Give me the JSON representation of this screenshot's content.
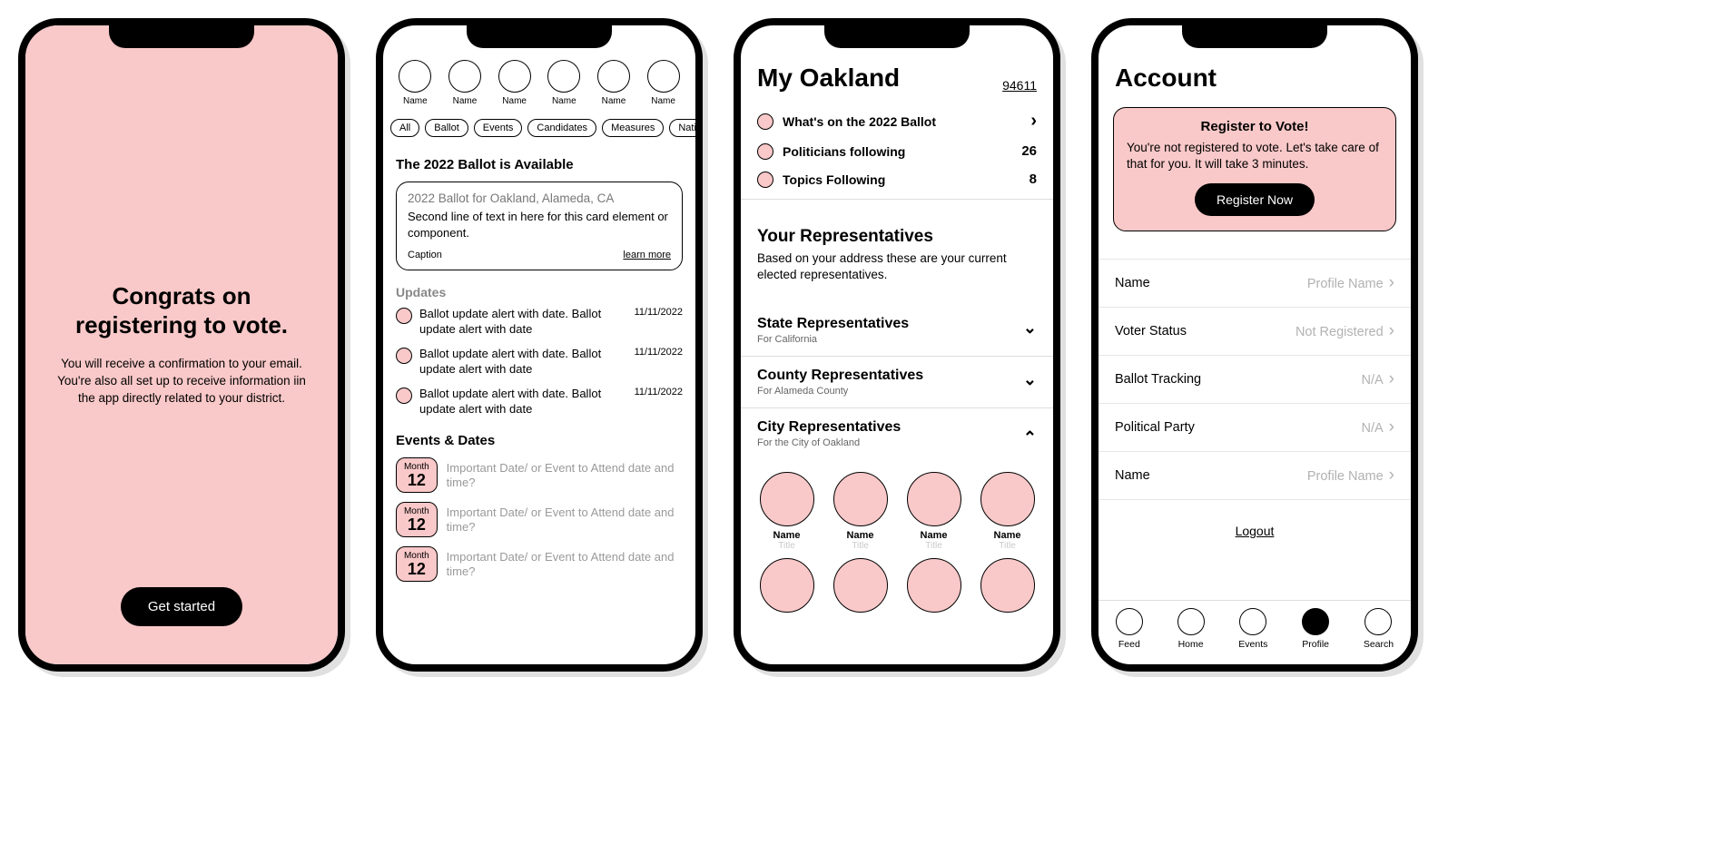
{
  "screen1": {
    "title": "Congrats on registering to vote.",
    "body": "You will receive a confirmation to your email. You're also all set up to receive information iin the app directly related to your district.",
    "button": "Get started"
  },
  "screen2": {
    "avatars": [
      {
        "label": "Name"
      },
      {
        "label": "Name"
      },
      {
        "label": "Name"
      },
      {
        "label": "Name"
      },
      {
        "label": "Name"
      },
      {
        "label": "Name"
      }
    ],
    "chips": [
      "All",
      "Ballot",
      "Events",
      "Candidates",
      "Measures",
      "National News"
    ],
    "ballot_heading": "The 2022 Ballot is Available",
    "card": {
      "title": "2022 Ballot for Oakland, Alameda, CA",
      "body": "Second line of text in here for this card element or component.",
      "caption": "Caption",
      "link": "learn more"
    },
    "updates_heading": "Updates",
    "updates": [
      {
        "text": "Ballot update alert with date. Ballot update alert with date",
        "date": "11/11/2022"
      },
      {
        "text": "Ballot update alert with date. Ballot update alert with date",
        "date": "11/11/2022"
      },
      {
        "text": "Ballot update alert with date. Ballot update alert with date",
        "date": "11/11/2022"
      }
    ],
    "events_heading": "Events & Dates",
    "events": [
      {
        "month": "Month",
        "day": "12",
        "text": "Important Date/ or Event to Attend date and time?"
      },
      {
        "month": "Month",
        "day": "12",
        "text": "Important Date/ or Event to Attend date and time?"
      },
      {
        "month": "Month",
        "day": "12",
        "text": "Important Date/ or Event to Attend date and time?"
      }
    ]
  },
  "screen3": {
    "title": "My Oakland",
    "zip": "94611",
    "links": [
      {
        "label": "What's on the 2022 Ballot",
        "value": "",
        "chevron": true
      },
      {
        "label": "Politicians following",
        "value": "26",
        "chevron": false
      },
      {
        "label": "Topics Following",
        "value": "8",
        "chevron": false
      }
    ],
    "reps_heading": "Your Representatives",
    "reps_sub": "Based on your address these are your current elected representatives.",
    "accordions": [
      {
        "title": "State Representatives",
        "sub": "For California",
        "open": false
      },
      {
        "title": "County Representatives",
        "sub": "For Alameda County",
        "open": false
      },
      {
        "title": "City Representatives",
        "sub": "For the City of Oakland",
        "open": true
      }
    ],
    "city_reps": [
      {
        "name": "Name",
        "title": "Title"
      },
      {
        "name": "Name",
        "title": "Title"
      },
      {
        "name": "Name",
        "title": "Title"
      },
      {
        "name": "Name",
        "title": "Title"
      }
    ]
  },
  "screen4": {
    "title": "Account",
    "register": {
      "heading": "Register to Vote!",
      "body": "You're not registered to vote. Let's take care of that for you. It will take 3 minutes.",
      "button": "Register Now"
    },
    "settings": [
      {
        "key": "Name",
        "value": "Profile Name"
      },
      {
        "key": "Voter Status",
        "value": "Not Registered"
      },
      {
        "key": "Ballot Tracking",
        "value": "N/A"
      },
      {
        "key": "Political Party",
        "value": "N/A"
      },
      {
        "key": "Name",
        "value": "Profile Name"
      }
    ],
    "logout": "Logout",
    "tabs": [
      {
        "label": "Feed",
        "active": false
      },
      {
        "label": "Home",
        "active": false
      },
      {
        "label": "Events",
        "active": false
      },
      {
        "label": "Profile",
        "active": true
      },
      {
        "label": "Search",
        "active": false
      }
    ]
  }
}
